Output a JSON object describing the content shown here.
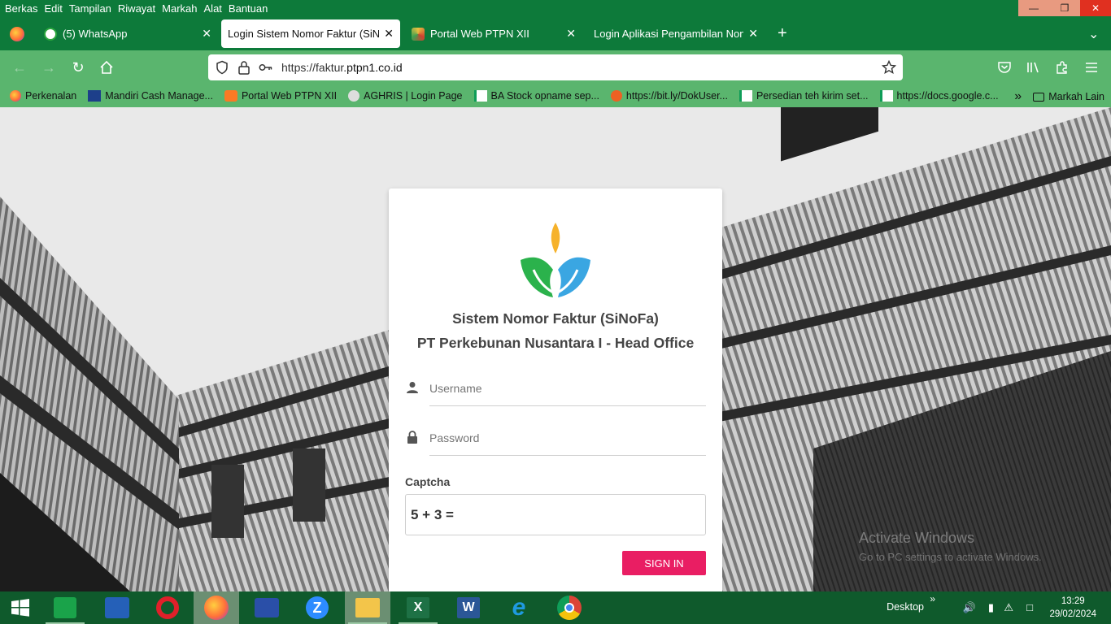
{
  "menu": [
    "Berkas",
    "Edit",
    "Tampilan",
    "Riwayat",
    "Markah",
    "Alat",
    "Bantuan"
  ],
  "tabs": [
    {
      "label": "(5) WhatsApp",
      "icon": "whatsapp-icon"
    },
    {
      "label": "Login Sistem Nomor Faktur (SiNoFa)",
      "icon": ""
    },
    {
      "label": "Portal Web PTPN XII",
      "icon": "ptpn-icon"
    },
    {
      "label": "Login Aplikasi Pengambilan Nomor",
      "icon": ""
    }
  ],
  "url": {
    "prefix": "https://faktur.",
    "domain": "ptpn1.co.id"
  },
  "bookmarks": [
    "Perkenalan",
    "Mandiri Cash Manage...",
    "Portal Web PTPN XII",
    "AGHRIS | Login Page",
    "BA Stock opname sep...",
    "https://bit.ly/DokUser...",
    "Persedian teh kirim set...",
    "https://docs.google.c..."
  ],
  "bookmarks_other": "Markah Lain",
  "login": {
    "title1": "Sistem Nomor Faktur (SiNoFa)",
    "title2": "PT Perkebunan Nusantara I - Head Office",
    "username_placeholder": "Username",
    "password_placeholder": "Password",
    "captcha_label": "Captcha",
    "captcha_question": "5 + 3 =",
    "signin": "SIGN IN"
  },
  "watermark": {
    "line1": "Activate Windows",
    "line2": "Go to PC settings to activate Windows."
  },
  "taskbar": {
    "desktop": "Desktop",
    "time": "13:29",
    "date": "29/02/2024"
  },
  "colors": {
    "accent": "#e91e63",
    "browser_green": "#0d7a3a",
    "nav_green": "#5ab56e"
  }
}
